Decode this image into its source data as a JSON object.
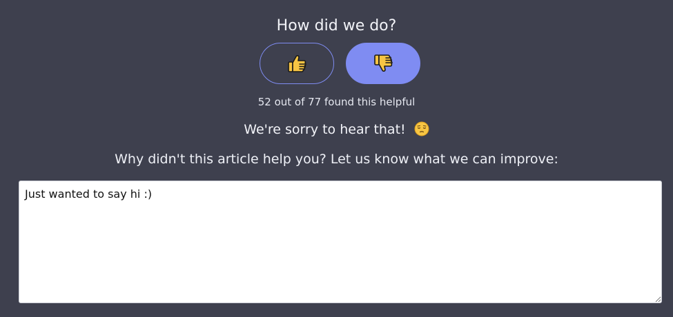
{
  "feedback": {
    "heading": "How did we do?",
    "thumbs_up": {
      "icon": "thumbs-up-icon",
      "selected": false
    },
    "thumbs_down": {
      "icon": "thumbs-down-icon",
      "selected": true
    },
    "helpful_count_text": "52 out of 77 found this helpful",
    "sorry_text": "We're sorry to hear that!",
    "sorry_emoji": "pensive-face-icon",
    "prompt": "Why didn't this article help you? Let us know what we can improve:",
    "textarea_value": "Just wanted to say hi :)"
  },
  "colors": {
    "background": "#3e404e",
    "accent": "#7f8cf2",
    "text": "#f2f3f8",
    "textarea_bg": "#ffffff"
  }
}
